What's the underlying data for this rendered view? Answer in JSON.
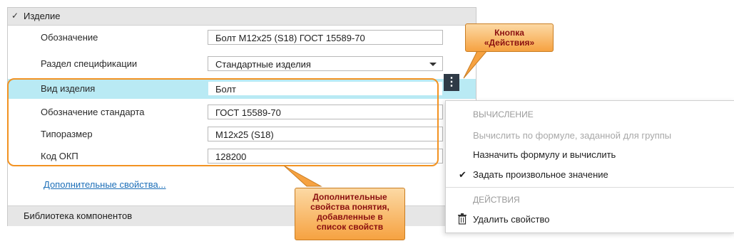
{
  "section": {
    "chevron": "✓",
    "title": "Изделие"
  },
  "rows": [
    {
      "label": "Обозначение",
      "value": "Болт М12x25 (S18) ГОСТ 15589-70"
    },
    {
      "label": "Раздел спецификации",
      "value": "Стандартные изделия"
    },
    {
      "label": "Вид изделия",
      "value": "Болт"
    },
    {
      "label": "Обозначение стандарта",
      "value": "ГОСТ 15589-70"
    },
    {
      "label": "Типоразмер",
      "value": "М12x25 (S18)"
    },
    {
      "label": "Код ОКП",
      "value": "128200"
    }
  ],
  "actions_button": {
    "glyph": "⋮"
  },
  "link": "Дополнительные свойства...",
  "library": "Библиотека компонентов",
  "menu": {
    "header1": "ВЫЧИСЛЕНИЕ",
    "item1": "Вычислить по формуле, заданной для группы",
    "item2": "Назначить формулу и вычислить",
    "item3": "Задать произвольное значение",
    "header2": "ДЕЙСТВИЯ",
    "item4": "Удалить свойство"
  },
  "callout1": {
    "line1": "Кнопка",
    "line2": "«Действия»"
  },
  "callout2": {
    "line1": "Дополнительные",
    "line2": "свойства понятия,",
    "line3": "добавленные в",
    "line4": "список свойств"
  },
  "colors": {
    "accent": "#f29221",
    "selected": "#b9eaf4",
    "callout_text": "#8b1010"
  }
}
